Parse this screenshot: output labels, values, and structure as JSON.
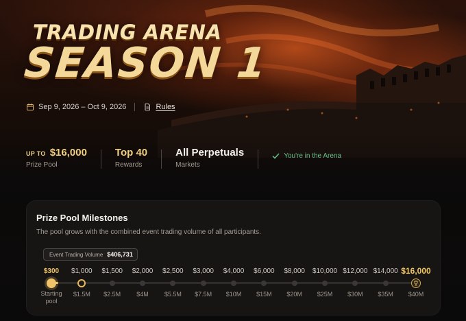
{
  "hero": {
    "title_line1": "TRADING ARENA",
    "title_line2": "SEASON 1",
    "dates": "Sep 9, 2026 – Oct 9, 2026",
    "rules_label": "Rules",
    "calendar_icon": "calendar-icon",
    "rules_icon": "document-icon"
  },
  "stats": {
    "prize_prefix": "UP TO",
    "prize_value": "$16,000",
    "prize_label": "Prize Pool",
    "rewards_value": "Top 40",
    "rewards_label": "Rewards",
    "markets_value": "All Perpetuals",
    "markets_label": "Markets",
    "status_text": "You're in the Arena",
    "status_icon": "check-icon"
  },
  "milestones": {
    "title": "Prize Pool Milestones",
    "subtitle": "The pool grows with the combined event trading volume of all participants.",
    "volume_label": "Event Trading Volume",
    "volume_value": "$406,731",
    "progress_fraction": 0.0102,
    "items": [
      {
        "amount": "$300",
        "volume_line1": "Starting",
        "volume_line2": "pool",
        "state": "current"
      },
      {
        "amount": "$1,000",
        "volume": "$1.5M",
        "state": "reached"
      },
      {
        "amount": "$1,500",
        "volume": "$2.5M",
        "state": "pending"
      },
      {
        "amount": "$2,000",
        "volume": "$4M",
        "state": "pending"
      },
      {
        "amount": "$2,500",
        "volume": "$5.5M",
        "state": "pending"
      },
      {
        "amount": "$3,000",
        "volume": "$7.5M",
        "state": "pending"
      },
      {
        "amount": "$4,000",
        "volume": "$10M",
        "state": "pending"
      },
      {
        "amount": "$6,000",
        "volume": "$15M",
        "state": "pending"
      },
      {
        "amount": "$8,000",
        "volume": "$20M",
        "state": "pending"
      },
      {
        "amount": "$10,000",
        "volume": "$25M",
        "state": "pending"
      },
      {
        "amount": "$12,000",
        "volume": "$30M",
        "state": "pending"
      },
      {
        "amount": "$14,000",
        "volume": "$35M",
        "state": "pending"
      },
      {
        "amount": "$16,000",
        "volume": "$40M",
        "state": "final"
      }
    ],
    "colors": {
      "accent": "#f1c46a",
      "status_green": "#69c08d"
    }
  }
}
